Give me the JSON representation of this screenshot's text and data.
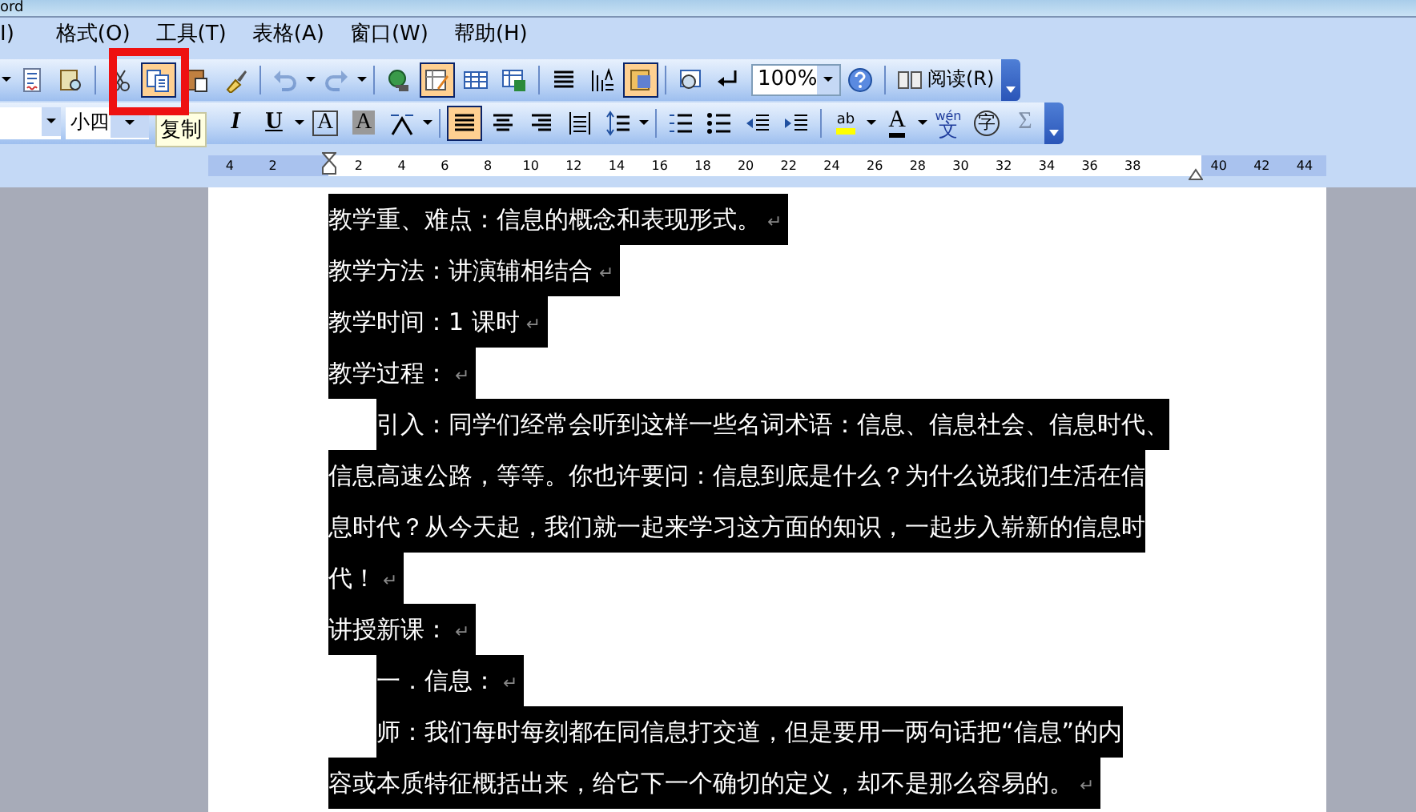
{
  "window": {
    "title": "ord"
  },
  "menu": [
    {
      "label": "I)"
    },
    {
      "label": "格式(O)"
    },
    {
      "label": "工具(T)"
    },
    {
      "label": "表格(A)"
    },
    {
      "label": "窗口(W)"
    },
    {
      "label": "帮助(H)"
    }
  ],
  "standard_toolbar": {
    "buttons": [
      {
        "pressed": false,
        "disabled": false
      },
      {
        "pressed": false,
        "disabled": false
      },
      {
        "pressed": false,
        "disabled": false
      },
      {
        "pressed": true,
        "disabled": false
      },
      {
        "pressed": false,
        "disabled": false
      },
      {
        "pressed": false,
        "disabled": false
      },
      {
        "pressed": false,
        "disabled": true
      },
      {
        "pressed": false,
        "disabled": true
      },
      {
        "pressed": false,
        "disabled": false
      },
      {
        "pressed": true,
        "disabled": false
      },
      {
        "pressed": false,
        "disabled": false
      },
      {
        "pressed": false,
        "disabled": false
      },
      {
        "pressed": false,
        "disabled": false
      },
      {
        "pressed": false,
        "disabled": false
      },
      {
        "pressed": true,
        "disabled": false
      },
      {
        "pressed": false,
        "disabled": false
      },
      {
        "pressed": false,
        "disabled": false
      },
      {
        "pressed": false,
        "disabled": false
      }
    ],
    "zoom": "100%",
    "read_button": "阅读(R)"
  },
  "formatting_toolbar": {
    "font_size": "小四",
    "buttons": [
      {
        "label": "I",
        "pressed": false
      },
      {
        "label": "U",
        "pressed": false
      },
      {
        "label": "A",
        "pressed": false
      },
      {
        "label": "A",
        "pressed": false
      },
      {
        "pressed": false
      },
      {
        "pressed": true
      },
      {
        "pressed": false
      },
      {
        "pressed": false
      },
      {
        "pressed": false
      },
      {
        "pressed": false
      },
      {
        "pressed": false
      },
      {
        "pressed": false
      },
      {
        "pressed": false
      },
      {
        "pressed": false
      },
      {
        "label": "ab",
        "pressed": false
      },
      {
        "label": "A",
        "pressed": false
      },
      {
        "label": "文",
        "ruby": "wén",
        "pressed": false
      },
      {
        "label": "字",
        "pressed": false
      },
      {
        "label": "Σ",
        "pressed": false
      }
    ]
  },
  "tooltip": "复制",
  "ruler": {
    "left_numbers": [
      "4",
      "2"
    ],
    "numbers": [
      "2",
      "4",
      "6",
      "8",
      "10",
      "12",
      "14",
      "16",
      "18",
      "20",
      "22",
      "24",
      "26",
      "28",
      "30",
      "32",
      "34",
      "36",
      "38"
    ],
    "right_numbers": [
      "40",
      "42",
      "44"
    ]
  },
  "document": {
    "paragraphs": [
      {
        "lines": [
          "教学重、难点：信息的概念和表现形式。"
        ],
        "mark": "↵",
        "indent": false,
        "selected": true
      },
      {
        "lines": [
          "教学方法：讲演辅相结合"
        ],
        "mark": "↵",
        "indent": false,
        "selected": true
      },
      {
        "lines": [
          "教学时间：1 课时"
        ],
        "mark": "↵",
        "indent": false,
        "selected": true
      },
      {
        "lines": [
          "教学过程："
        ],
        "mark": "↵",
        "indent": false,
        "selected": true
      },
      {
        "lines": [
          "引入：同学们经常会听到这样一些名词术语：信息、信息社会、信息时代、",
          "信息高速公路，等等。你也许要问：信息到底是什么？为什么说我们生活在信",
          "息时代？从今天起，我们就一起来学习这方面的知识，一起步入崭新的信息时",
          "代！"
        ],
        "mark": "↵",
        "indent": true,
        "selected": true
      },
      {
        "lines": [
          "讲授新课："
        ],
        "mark": "↵",
        "indent": false,
        "selected": true
      },
      {
        "lines": [
          "一．信息："
        ],
        "mark": "↵",
        "indent": true,
        "selected": true
      },
      {
        "lines": [
          "师：我们每时每刻都在同信息打交道，但是要用一两句话把“信息”的内",
          "容或本质特征概括出来，给它下一个确切的定义，却不是那么容易的。"
        ],
        "mark": "↵",
        "indent": true,
        "selected": true
      }
    ]
  },
  "annotation": {
    "kind": "frame"
  }
}
